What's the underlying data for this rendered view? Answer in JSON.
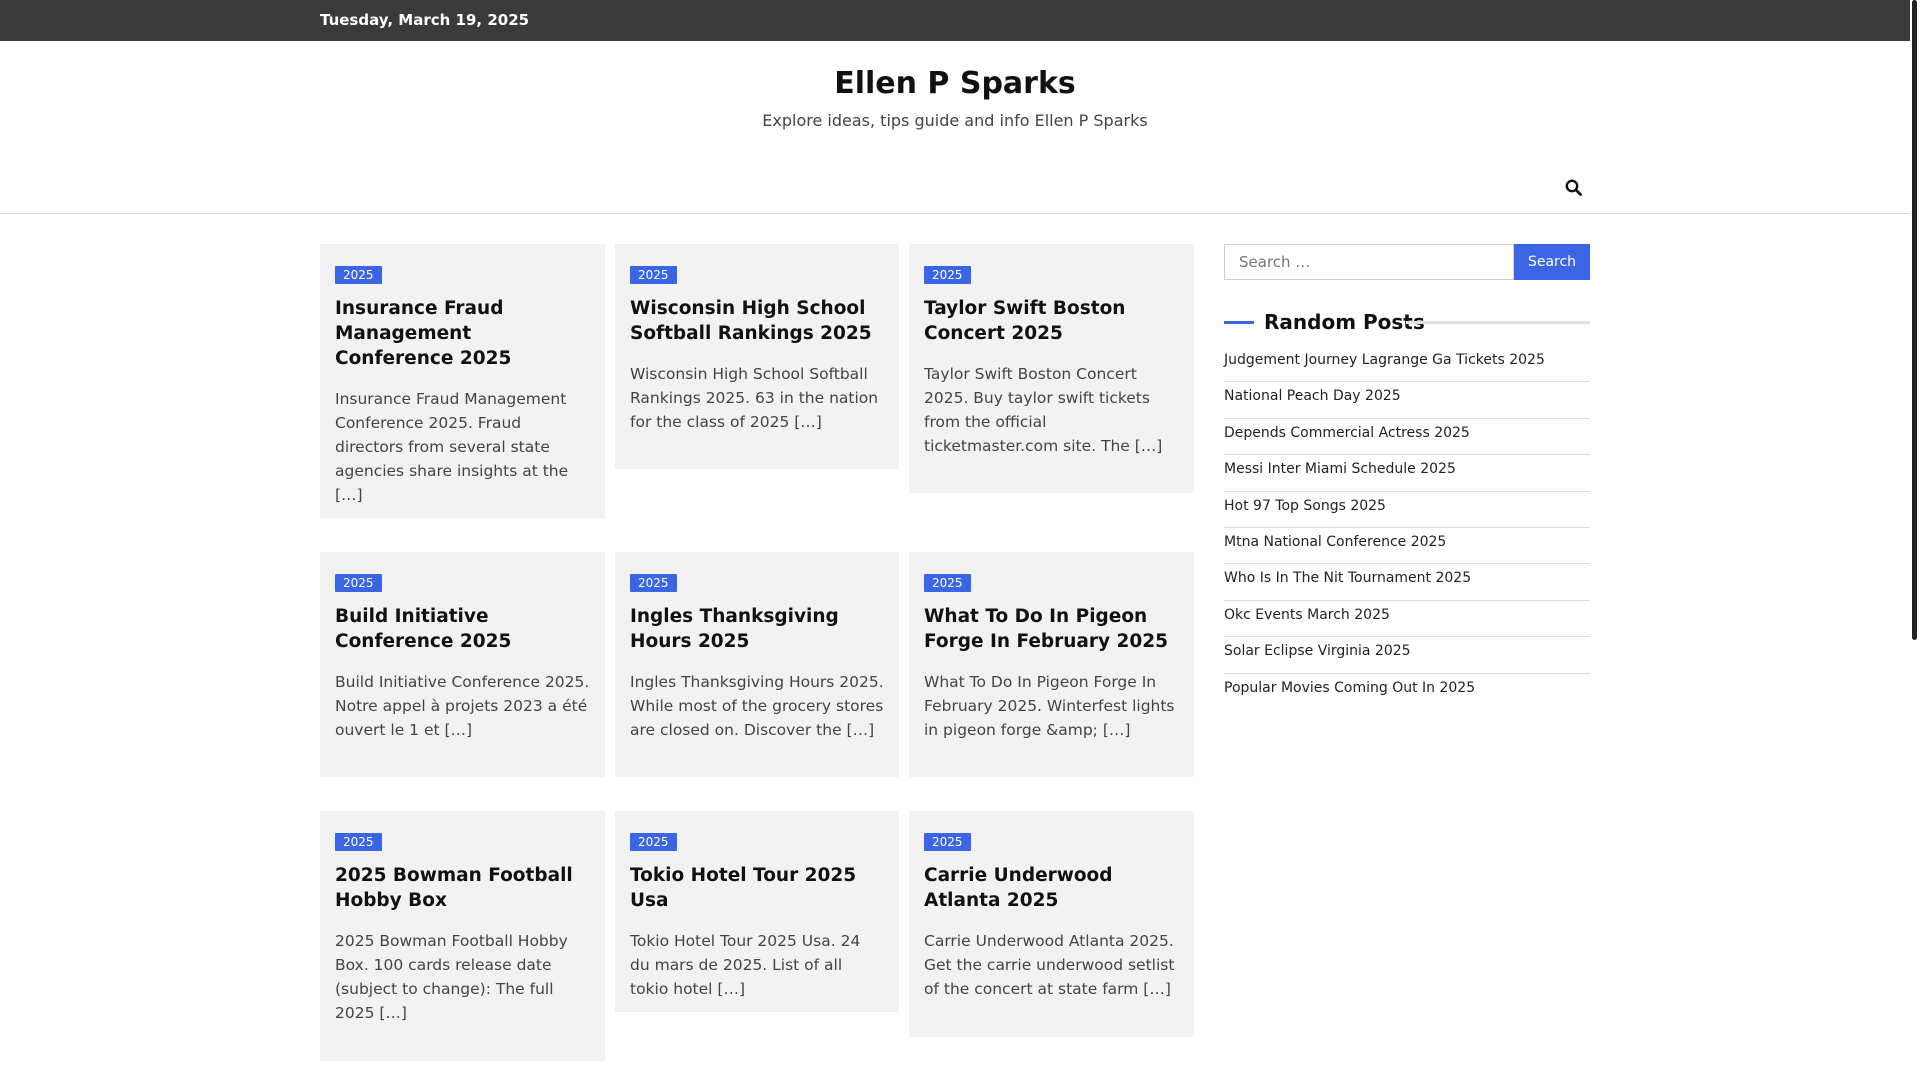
{
  "topbar": {
    "date": "Tuesday, March 19, 2025"
  },
  "header": {
    "title": "Ellen P Sparks",
    "tagline": "Explore ideas, tips guide and info Ellen P Sparks"
  },
  "posts": [
    {
      "badge": "2025",
      "title": "Insurance Fraud Management Conference 2025",
      "excerpt": "Insurance Fraud Management Conference 2025. Fraud directors from several state agencies share insights at the […]"
    },
    {
      "badge": "2025",
      "title": "Wisconsin High School Softball Rankings 2025",
      "excerpt": "Wisconsin High School Softball Rankings 2025. 63 in the nation for the class of 2025 […]"
    },
    {
      "badge": "2025",
      "title": "Taylor Swift Boston Concert 2025",
      "excerpt": "Taylor Swift Boston Concert 2025. Buy taylor swift tickets from the official ticketmaster.com site. The […]"
    },
    {
      "badge": "2025",
      "title": "Build Initiative Conference 2025",
      "excerpt": "Build Initiative Conference 2025. Notre appel à projets 2023 a été ouvert le 1 et […]"
    },
    {
      "badge": "2025",
      "title": "Ingles Thanksgiving Hours 2025",
      "excerpt": "Ingles Thanksgiving Hours 2025. While most of the grocery stores are closed on. Discover the […]"
    },
    {
      "badge": "2025",
      "title": "What To Do In Pigeon Forge In February 2025",
      "excerpt": "What To Do In Pigeon Forge In February 2025. Winterfest lights in pigeon forge &amp; […]"
    },
    {
      "badge": "2025",
      "title": "2025 Bowman Football Hobby Box",
      "excerpt": "2025 Bowman Football Hobby Box. 100 cards release date (subject to change): The full 2025 […]"
    },
    {
      "badge": "2025",
      "title": "Tokio Hotel Tour 2025 Usa",
      "excerpt": "Tokio Hotel Tour 2025 Usa. 24 du mars de 2025. List of all tokio hotel […]"
    },
    {
      "badge": "2025",
      "title": "Carrie Underwood Atlanta 2025",
      "excerpt": "Carrie Underwood Atlanta 2025. Get the carrie underwood setlist of the concert at state farm […]"
    }
  ],
  "sidebar": {
    "search": {
      "placeholder": "Search …",
      "button": "Search"
    },
    "random_posts_heading": "Random Posts",
    "random_posts": [
      "Judgement Journey Lagrange Ga Tickets 2025",
      "National Peach Day 2025",
      "Depends Commercial Actress 2025",
      "Messi Inter Miami Schedule 2025",
      "Hot 97 Top Songs 2025",
      "Mtna National Conference 2025",
      "Who Is In The Nit Tournament 2025",
      "Okc Events March 2025",
      "Solar Eclipse Virginia 2025",
      "Popular Movies Coming Out In 2025"
    ]
  },
  "icons": {
    "nav_search": "search-icon"
  },
  "colors": {
    "accent": "#3a66e6",
    "topbar": "#3a3a3a",
    "card_bg": "#f2f2f2"
  }
}
